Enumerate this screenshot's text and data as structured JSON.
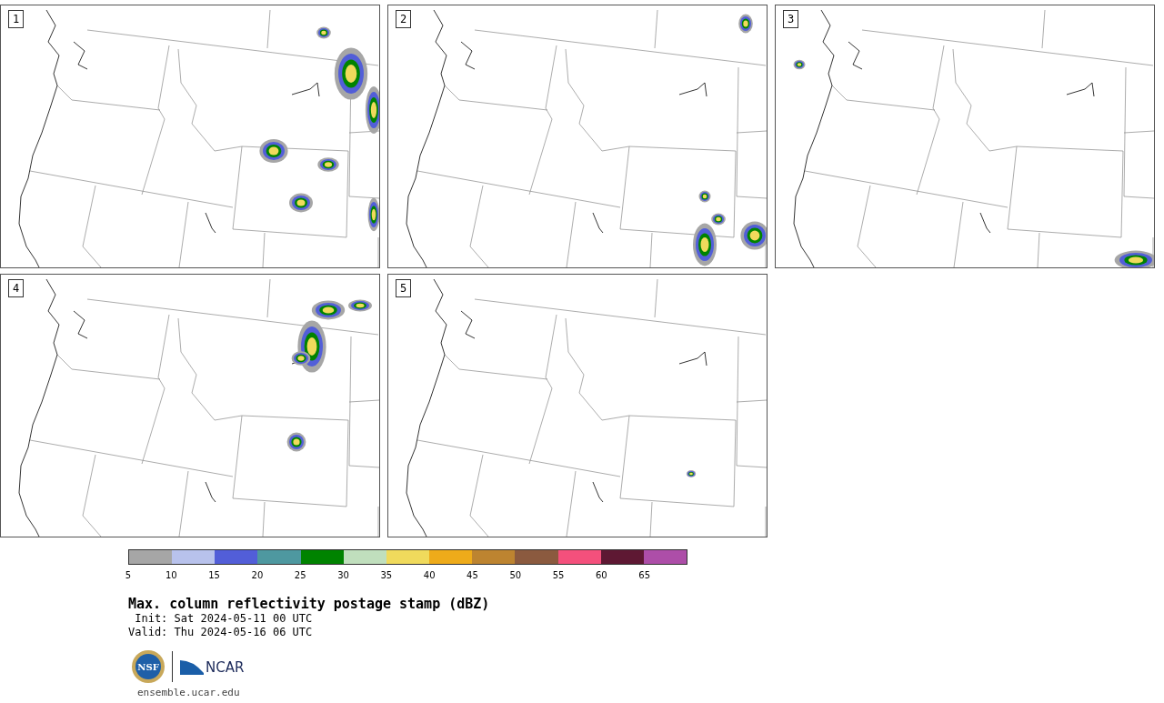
{
  "panels": [
    {
      "label": "1"
    },
    {
      "label": "2"
    },
    {
      "label": "3"
    },
    {
      "label": "4"
    },
    {
      "label": "5"
    }
  ],
  "colorbar": {
    "segments": [
      {
        "color": "#a6a6a6"
      },
      {
        "color": "#b8c2ec"
      },
      {
        "color": "#525ed8"
      },
      {
        "color": "#4e98a0"
      },
      {
        "color": "#008300"
      },
      {
        "color": "#c0dfbd"
      },
      {
        "color": "#f0da5c"
      },
      {
        "color": "#eeab1a"
      },
      {
        "color": "#bd8430"
      },
      {
        "color": "#8b5a3f"
      },
      {
        "color": "#f4507c"
      },
      {
        "color": "#5e1833"
      },
      {
        "color": "#ad4ea8"
      }
    ],
    "ticks": [
      "5",
      "10",
      "15",
      "20",
      "25",
      "30",
      "35",
      "40",
      "45",
      "50",
      "55",
      "60",
      "65"
    ]
  },
  "title": "Max. column reflectivity postage stamp (dBZ)",
  "init": " Init: Sat 2024-05-11 00 UTC",
  "valid": "Valid: Thu 2024-05-16 06 UTC",
  "logos": {
    "ncar": "NCAR",
    "nsf": "NSF"
  },
  "footer": "ensemble.ucar.edu"
}
